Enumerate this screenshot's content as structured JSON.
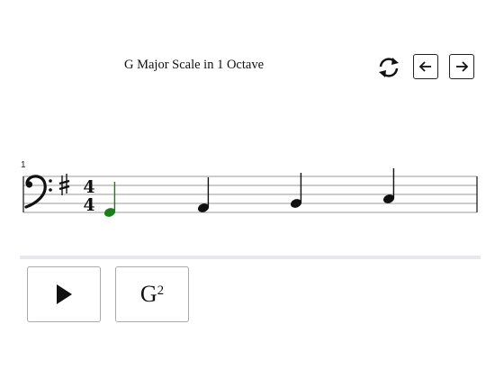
{
  "header": {
    "title": "G Major Scale in 1 Octave"
  },
  "toolbar": {
    "refresh_icon": "refresh-icon",
    "prev_icon": "arrow-left-icon",
    "next_icon": "arrow-right-icon"
  },
  "score": {
    "measure_number": "1",
    "clef": "bass",
    "key_signature": "G major (1 sharp)",
    "time_signature": {
      "top": "4",
      "bottom": "4"
    },
    "notes": [
      {
        "pitch": "G2",
        "duration": "quarter",
        "color": "#1a7f1a"
      },
      {
        "pitch": "A2",
        "duration": "quarter",
        "color": "#111111"
      },
      {
        "pitch": "B2",
        "duration": "quarter",
        "color": "#111111"
      },
      {
        "pitch": "C3",
        "duration": "quarter",
        "color": "#111111"
      }
    ]
  },
  "controls": {
    "play_icon": "play-icon",
    "note_letter": "G",
    "note_octave": "2"
  },
  "colors": {
    "current_note": "#1a7f1a",
    "divider": "#e8e8ec"
  }
}
